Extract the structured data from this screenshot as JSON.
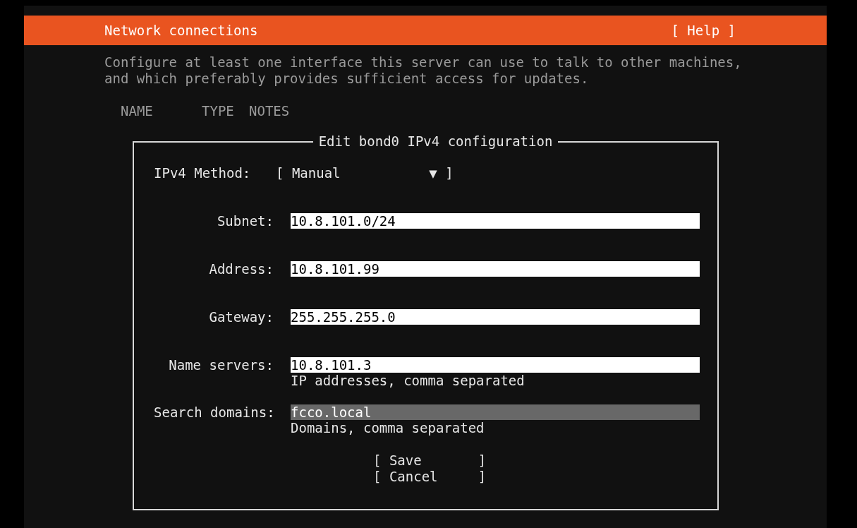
{
  "header": {
    "title": "Network connections",
    "help": "[ Help ]"
  },
  "description": [
    "Configure at least one interface this server can use to talk to other machines,",
    "and which preferably provides sufficient access for updates."
  ],
  "table": {
    "columns": [
      "NAME",
      "TYPE",
      "NOTES"
    ]
  },
  "dialog": {
    "title": "Edit bond0 IPv4 configuration",
    "method": {
      "label": "IPv4 Method:",
      "value": "[ Manual           ▼ ]"
    },
    "fields": [
      {
        "label": "Subnet:",
        "value": "10.8.101.0/24",
        "focused": false
      },
      {
        "label": "Address:",
        "value": "10.8.101.99",
        "focused": false
      },
      {
        "label": "Gateway:",
        "value": "255.255.255.0",
        "focused": false
      },
      {
        "label": "Name servers:",
        "value": "10.8.101.3",
        "hint": "IP addresses, comma separated",
        "focused": false
      },
      {
        "label": "Search domains:",
        "value": "fcco.local",
        "hint": "Domains, comma separated",
        "focused": true
      }
    ],
    "buttons": [
      {
        "label": "[ Save       ]"
      },
      {
        "label": "[ Cancel     ]"
      }
    ]
  }
}
